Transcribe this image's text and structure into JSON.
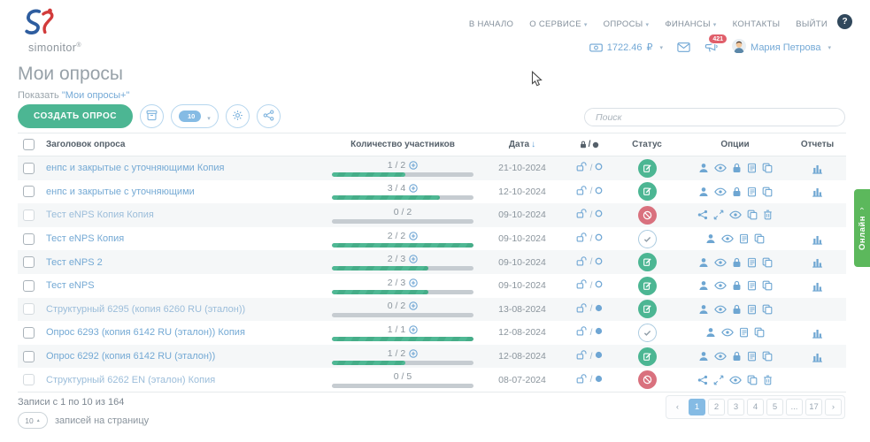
{
  "logo": {
    "brand": "simonitor",
    "reg": "®"
  },
  "nav": {
    "items": [
      {
        "label": "В НАЧАЛО",
        "caret": false
      },
      {
        "label": "О СЕРВИСЕ",
        "caret": true
      },
      {
        "label": "ОПРОСЫ",
        "caret": true
      },
      {
        "label": "ФИНАНСЫ",
        "caret": true
      },
      {
        "label": "КОНТАКТЫ",
        "caret": false
      },
      {
        "label": "ВЫЙТИ",
        "caret": false
      }
    ],
    "help_icon": "question-icon"
  },
  "userbar": {
    "balance": "1722.46",
    "currency": "₽",
    "badge": "421",
    "user": "Мария Петрова",
    "icons": [
      "banknote-icon",
      "envelope-icon",
      "megaphone-icon",
      "avatar"
    ]
  },
  "page": {
    "title": "Мои опросы",
    "show_label": "Показать",
    "show_link": "\"Мои опросы+\""
  },
  "toolbar": {
    "create_label": "СОЗДАТЬ ОПРОС",
    "filter_value": "10",
    "buttons": [
      "archive-icon",
      "filter-toggle",
      "gear-icon",
      "share-icon"
    ],
    "search_placeholder": "Поиск"
  },
  "table": {
    "headers": {
      "title": "Заголовок опроса",
      "participants": "Количество участников",
      "date": "Дата",
      "date_sort": "↓",
      "privacy": "lock-icon / circle-filled-icon",
      "status": "Статус",
      "options": "Опции",
      "reports": "Отчеты"
    },
    "privacy_sep": "/",
    "rows": [
      {
        "title": "енпс и закрытые с уточняющими Копия",
        "participants": "1 / 2",
        "plus": true,
        "progress": 52,
        "date": "21-10-2024",
        "privacy": "open",
        "status": "active",
        "options": [
          "user-icon",
          "eye-icon",
          "lock-icon",
          "docs-icon",
          "copy-icon"
        ],
        "report": true,
        "checkbox": "enabled"
      },
      {
        "title": "енпс и закрытые с уточняющими",
        "participants": "3 / 4",
        "plus": true,
        "progress": 76,
        "date": "12-10-2024",
        "privacy": "open",
        "status": "active",
        "options": [
          "user-icon",
          "eye-icon",
          "lock-icon",
          "docs-icon",
          "copy-icon"
        ],
        "report": true,
        "checkbox": "enabled"
      },
      {
        "title": "Тест eNPS Копия Копия",
        "participants": "0 / 2",
        "plus": false,
        "progress": 0,
        "date": "09-10-2024",
        "privacy": "open",
        "status": "blocked",
        "options": [
          "network-icon",
          "move-icon",
          "eye-icon",
          "copy-icon",
          "trash-icon"
        ],
        "report": false,
        "checkbox": "disabled"
      },
      {
        "title": "Тест eNPS Копия",
        "participants": "2 / 2",
        "plus": true,
        "progress": 100,
        "date": "09-10-2024",
        "privacy": "open",
        "status": "done",
        "options": [
          "user-icon",
          "eye-icon",
          "docs-icon",
          "copy-icon"
        ],
        "report": true,
        "checkbox": "enabled"
      },
      {
        "title": "Тест eNPS 2",
        "participants": "2 / 3",
        "plus": true,
        "progress": 68,
        "date": "09-10-2024",
        "privacy": "open",
        "status": "active",
        "options": [
          "user-icon",
          "eye-icon",
          "lock-icon",
          "docs-icon",
          "copy-icon"
        ],
        "report": true,
        "checkbox": "enabled"
      },
      {
        "title": "Тест eNPS",
        "participants": "2 / 3",
        "plus": true,
        "progress": 68,
        "date": "09-10-2024",
        "privacy": "open",
        "status": "active",
        "options": [
          "user-icon",
          "eye-icon",
          "lock-icon",
          "docs-icon",
          "copy-icon"
        ],
        "report": true,
        "checkbox": "enabled"
      },
      {
        "title": "Структурный 6295 (копия 6260 RU (эталон))",
        "participants": "0 / 2",
        "plus": true,
        "progress": 0,
        "date": "13-08-2024",
        "privacy": "filled",
        "status": "active",
        "options": [
          "user-icon",
          "eye-icon",
          "lock-icon",
          "docs-icon",
          "copy-icon"
        ],
        "report": false,
        "checkbox": "disabled"
      },
      {
        "title": "Опрос 6293 (копия 6142 RU (эталон)) Копия",
        "participants": "1 / 1",
        "plus": true,
        "progress": 100,
        "date": "12-08-2024",
        "privacy": "filled",
        "status": "done",
        "options": [
          "user-icon",
          "eye-icon",
          "docs-icon",
          "copy-icon"
        ],
        "report": true,
        "checkbox": "enabled"
      },
      {
        "title": "Опрос 6292 (копия 6142 RU (эталон))",
        "participants": "1 / 2",
        "plus": true,
        "progress": 52,
        "date": "12-08-2024",
        "privacy": "filled",
        "status": "active",
        "options": [
          "user-icon",
          "eye-icon",
          "lock-icon",
          "docs-icon",
          "copy-icon"
        ],
        "report": true,
        "checkbox": "enabled"
      },
      {
        "title": "Структурный 6262 EN (эталон) Копия",
        "participants": "0 / 5",
        "plus": false,
        "progress": 0,
        "date": "08-07-2024",
        "privacy": "filled",
        "status": "blocked",
        "options": [
          "network-icon",
          "move-icon",
          "eye-icon",
          "copy-icon",
          "trash-icon"
        ],
        "report": false,
        "checkbox": "disabled"
      }
    ]
  },
  "footer": {
    "records": "Записи с 1 по 10 из 164",
    "per_page": "10",
    "per_page_label": "записей на страницу",
    "pagination": [
      {
        "label": "‹",
        "type": "prev"
      },
      {
        "label": "1",
        "active": true
      },
      {
        "label": "2"
      },
      {
        "label": "3"
      },
      {
        "label": "4"
      },
      {
        "label": "5"
      },
      {
        "label": "...",
        "type": "ellipsis"
      },
      {
        "label": "17"
      },
      {
        "label": "›",
        "type": "next"
      }
    ]
  },
  "side_tab": {
    "label": "Онлайн"
  },
  "colors": {
    "accent_green": "#4cb693",
    "status_red": "#d9717e",
    "link_blue": "#74a9d4",
    "pagination_active": "#85bbe4",
    "side_tab_green": "#5cb85c"
  }
}
